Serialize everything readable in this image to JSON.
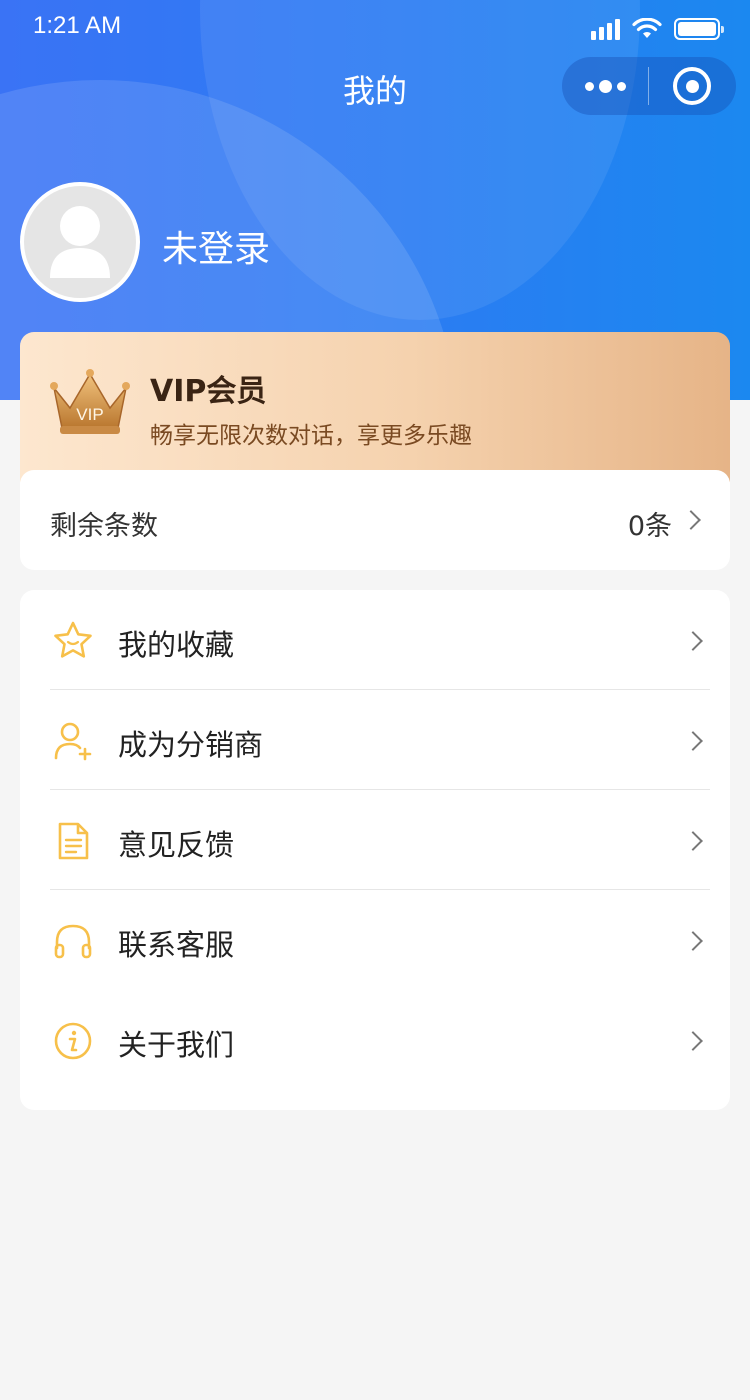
{
  "status_bar": {
    "time": "1:21 AM"
  },
  "nav": {
    "title": "我的"
  },
  "user": {
    "name": "未登录"
  },
  "vip": {
    "title": "VIP会员",
    "subtitle": "畅享无限次数对话，享更多乐趣",
    "badge_text": "VIP"
  },
  "remaining": {
    "label": "剩余条数",
    "value": "0条"
  },
  "menu": {
    "items": [
      {
        "label": "我的收藏",
        "icon": "star-icon"
      },
      {
        "label": "成为分销商",
        "icon": "user-add-icon"
      },
      {
        "label": "意见反馈",
        "icon": "document-icon"
      },
      {
        "label": "联系客服",
        "icon": "headphones-icon"
      },
      {
        "label": "关于我们",
        "icon": "info-icon"
      }
    ]
  },
  "colors": {
    "brand_blue": "#2b7cf2",
    "icon_accent": "#f7c04a",
    "page_bg": "#f5f5f5"
  }
}
